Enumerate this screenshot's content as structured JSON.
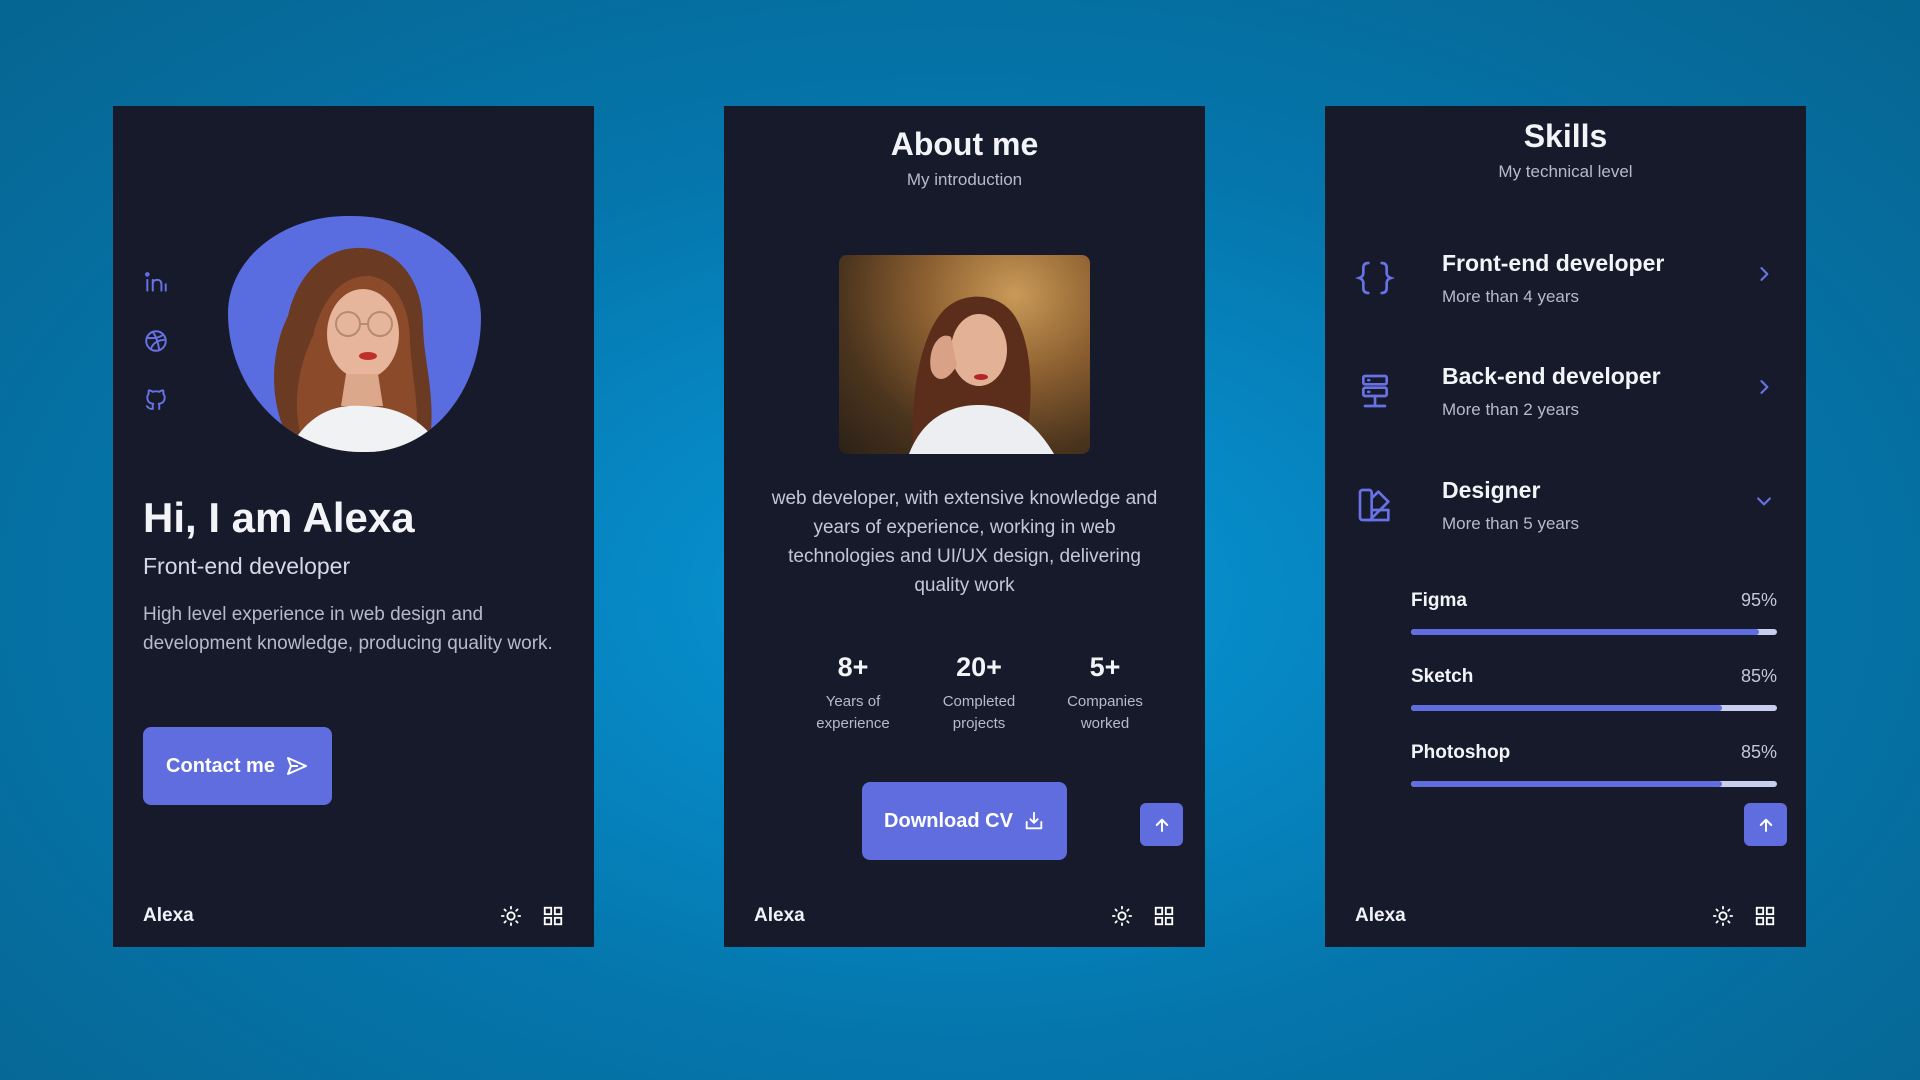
{
  "panel_home": {
    "hero_title": "Hi, I am Alexa",
    "hero_subtitle": "Front-end developer",
    "hero_description": "High level experience in web design and development knowledge, producing quality work.",
    "contact_label": "Contact me",
    "socials": [
      "linkedin-icon",
      "dribbble-icon",
      "github-icon"
    ]
  },
  "panel_about": {
    "title": "About me",
    "subtitle": "My introduction",
    "description": "web developer, with extensive knowledge and years of experience, working in web technologies and UI/UX design, delivering quality work",
    "stats": [
      {
        "value": "8+",
        "label": "Years of experience"
      },
      {
        "value": "20+",
        "label": "Completed projects"
      },
      {
        "value": "5+",
        "label": "Companies worked"
      }
    ],
    "download_label": "Download CV"
  },
  "panel_skills": {
    "title": "Skills",
    "subtitle": "My technical level",
    "skills": [
      {
        "title": "Front-end developer",
        "subtitle": "More than 4 years",
        "icon": "code-braces-icon",
        "state": "collapsed"
      },
      {
        "title": "Back-end developer",
        "subtitle": "More than 2 years",
        "icon": "server-icon",
        "state": "collapsed"
      },
      {
        "title": "Designer",
        "subtitle": "More than 5 years",
        "icon": "swatchbook-icon",
        "state": "expanded"
      }
    ],
    "designer_bars": [
      {
        "name": "Figma",
        "percent_label": "95%",
        "value": 95
      },
      {
        "name": "Sketch",
        "percent_label": "85%",
        "value": 85
      },
      {
        "name": "Photoshop",
        "percent_label": "85%",
        "value": 85
      }
    ]
  },
  "footer": {
    "brand": "Alexa",
    "icons": [
      "sun-icon",
      "grid-icon"
    ]
  },
  "colors": {
    "accent": "#5f6ddf",
    "panel_bg": "#171a2a",
    "page_bg": "#0a99d6"
  }
}
